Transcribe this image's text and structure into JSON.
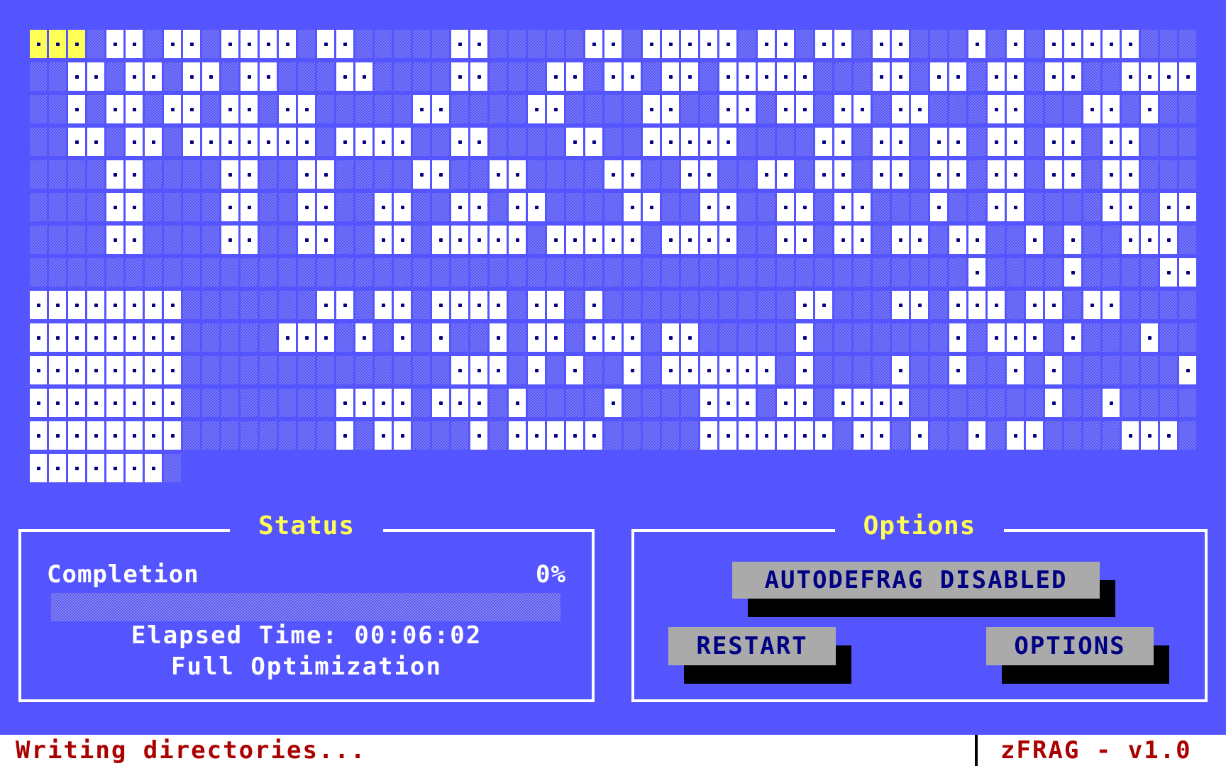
{
  "disk_map": {
    "cols": 61,
    "rows_data": [
      "CCCE##E##E####E##EEEEE##EEEEE##E#####E##E##E##EEE#E#E#####EEE",
      "EE##E##E##E##EEE##EEEE##EEE##E##E##E#####EEE##E##E##E##EE####E##EEE",
      "EE#E##E##E##E##EEEEE##EEEE##EEEE##EE##E##E##E##EEE##EEE##E#EEEE#EE",
      "EE##E##E#######E####EE##EEEE##EE#####EEEE##E##E##E##E##E##EEEE#EEEE##E###",
      "EEEE##EEEE##EE##EEEE##EE##EEEE##EE##EE##E##E##E##E##E##E##EEEEE##E##E#E###",
      "EEEE##EEEE##EE##EE##EE##E##EEEE##EE##EE##E##EEE#EE##EEEE##E##E#E#EE###E",
      "EEEE##EEEE##EE##EE##E#####E#####E####EE##E##E##E##EE#E#EE###E##E#E##E",
      "EEEEEEEEEEEEEEEEEEEEEEEEEEEEEEEEEEEEEEEEEEEEEEEEE#EEEE#EEEE##EEE##",
      "########EEEEEEE##E##E####E##E#EEEEEEEEEE##EEE##E###E##E##EEEE#EEE##E",
      "########EEEEE###E#E#E#EE#E##E###E##EEEEE#EEEEEEE#E###E#EEE#EEE#E#EEE#E",
      "########EEEEEEEEEEEEEE###E#E#EE#E######E#EEEE#EE#EE#E#EEEEEE##E#EE##E",
      "########EEEEEEEE####E###E#EEEE#EEEE###E##E####EEEEEEE#EE#EEEEEEEE##E",
      "########EEEEEEEE#E##EEE#E#####EEEEE#######E##E#EE#E##EEEE###EEEEE#E",
      "#######E"
    ]
  },
  "status_panel": {
    "title": "Status",
    "completion_label": "Completion",
    "completion_percent_text": "0%",
    "progress_fraction": 0.0,
    "elapsed_time": "Elapsed Time: 00:06:02",
    "mode": "Full Optimization"
  },
  "options_panel": {
    "title": "Options",
    "autodefrag_label": "AUTODEFRAG DISABLED",
    "restart_label": "RESTART",
    "options_label": "OPTIONS"
  },
  "status_bar": {
    "message": "Writing directories...",
    "app_version": "zFRAG - v1.0"
  },
  "colors": {
    "background": "#5555ff",
    "used_block": "#ffffff",
    "current_block": "#ffff55",
    "title_text": "#ffff55",
    "button_face": "#aaaaaa",
    "button_text": "#000084",
    "status_text": "#aa0000"
  }
}
